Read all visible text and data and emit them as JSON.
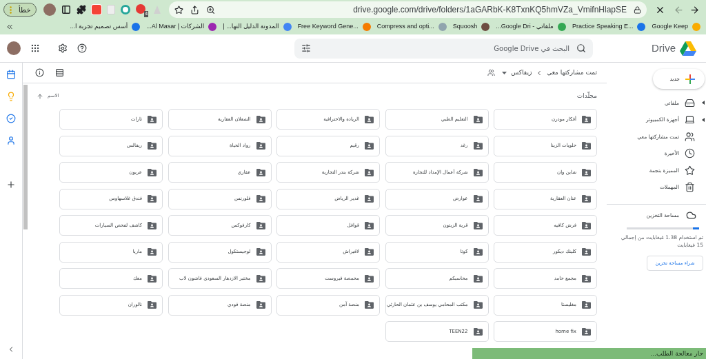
{
  "browser": {
    "profile_chip": "خطأ",
    "extension_badge": "4",
    "url": "drive.google.com/drive/folders/1aGARbK-K8TxnKQ5hmVZa_VmifnHlapSE",
    "bookmarks": [
      {
        "label": "Google Keep",
        "color": "#f9ab00"
      },
      {
        "label": "Practice Speaking E...",
        "color": "#1a73e8"
      },
      {
        "label": "ملفاتي - Google Dri...",
        "color": "#34a853"
      },
      {
        "label": "Squoosh",
        "color": "#6d4c41"
      },
      {
        "label": "Compress and opti...",
        "color": "#90a4ae"
      },
      {
        "label": "Free Keyword Gene...",
        "color": "#f57c00"
      },
      {
        "label": "المدونة الدليل النها... |",
        "color": "#4285f4"
      },
      {
        "label": "الشركات | Al Masar...",
        "color": "#9c27b0"
      },
      {
        "label": "أسس تصميم تجربة ا...",
        "color": "#1a73e8"
      }
    ]
  },
  "drive": {
    "product_name": "Drive",
    "search": {
      "placeholder": "البحث في Google Drive"
    },
    "breadcrumb": [
      "تمت مشاركتها معي",
      "زيفاكس"
    ],
    "section_title": "مجلّدات",
    "sort_label": "الاسم",
    "folders": [
      "أفكار مودرن",
      "التعليم الطبي",
      "الريادة والاحترافية",
      "الشعلان العقارية",
      "ثارات",
      "حلويات الزينا",
      "رغد",
      "رقيم",
      "رواد الحياة",
      "ريفالس",
      "شاين وان",
      "شركة أعمال الإمداد للتجارة",
      "شركة بندر التجارية",
      "عقاري",
      "عربون",
      "عنان العقارية",
      "عوارض",
      "غدير الرياض",
      "فلورنس",
      "فندق غلاسهاوس",
      "فرش كافيه",
      "قرية الزيتون",
      "قوافل",
      "كارفوكس",
      "كاشف لفحص السيارات",
      "كلينك ديكور",
      "كوتا",
      "لافيراش",
      "لوجيستكول",
      "ماريا",
      "مجمع حامد",
      "محاسبكم",
      "محمصة فيروست",
      "مختبر الازدهار السعودي فاشون لاب",
      "معك",
      "مغليستا",
      "مكتب المحامي يوسف بن عثمان الحارثي",
      "منصة آمن",
      "منصة فودي",
      "نالوران",
      "home fix",
      "TEEN22"
    ],
    "sidebar": {
      "new_button": "جديد",
      "items": [
        {
          "label": "ملفاتي",
          "kind": "drive",
          "expandable": true
        },
        {
          "label": "أجهزة الكمبيوتر",
          "kind": "computers",
          "expandable": true
        },
        {
          "label": "تمت مشاركتها معي",
          "kind": "shared",
          "expandable": false
        },
        {
          "label": "الأخيرة",
          "kind": "recent",
          "expandable": false
        },
        {
          "label": "المميزة بنجمة",
          "kind": "starred",
          "expandable": false
        },
        {
          "label": "المهملات",
          "kind": "trash",
          "expandable": false
        }
      ],
      "storage": {
        "title": "مساحة التخزين",
        "level": 0.09,
        "usage": "تم استخدام 1.38 غيغابايت من إجمالي 15 غيغابايت",
        "buy_button": "شراء مساحة تخزين"
      }
    },
    "toast": "جار معالجة الطلب..."
  }
}
